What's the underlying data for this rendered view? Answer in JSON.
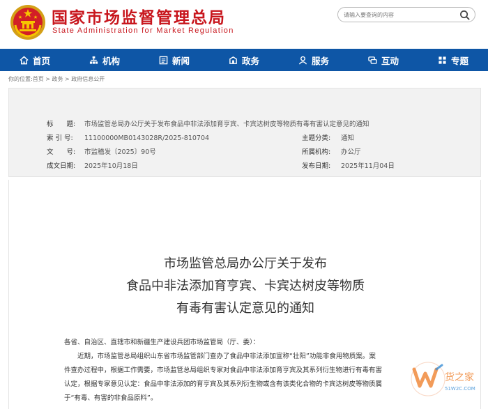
{
  "header": {
    "title": "国家市场监督管理总局",
    "subtitle": "State Administration for Market Regulation",
    "search_placeholder": "请输入要查询的内容"
  },
  "nav": [
    {
      "label": "首页",
      "icon": "home-icon"
    },
    {
      "label": "机构",
      "icon": "org-icon"
    },
    {
      "label": "新闻",
      "icon": "news-icon"
    },
    {
      "label": "政务",
      "icon": "affairs-icon"
    },
    {
      "label": "服务",
      "icon": "service-icon"
    },
    {
      "label": "互动",
      "icon": "chat-icon"
    },
    {
      "label": "专题",
      "icon": "topic-icon"
    }
  ],
  "breadcrumb": {
    "prefix": "你的位置:",
    "items": [
      "首页",
      "政务",
      "政府信息公开"
    ],
    "sep": " > "
  },
  "info": {
    "title_label": "标　　题:",
    "title_value": "市场监管总局办公厅关于发布食品中非法添加育亨宾、卡宾达树皮等物质有毒有害认定意见的通知",
    "index_label": "索 引 号:",
    "index_value": "11100000MB0143028R/2025-810704",
    "category_label": "主题分类:",
    "category_value": "通知",
    "docno_label": "文　　号:",
    "docno_value": "市监稽发〔2025〕90号",
    "org_label": "所属机构:",
    "org_value": "办公厅",
    "date_label": "成文日期:",
    "date_value": "2025年10月18日",
    "pub_label": "发布日期:",
    "pub_value": "2025年11月04日"
  },
  "article": {
    "title_lines": [
      "市场监管总局办公厅关于发布",
      "食品中非法添加育亨宾、卡宾达树皮等物质",
      "有毒有害认定意见的通知"
    ],
    "paragraphs": [
      "各省、自治区、直辖市和新疆生产建设兵团市场监管局（厅、委）：",
      "　　近期，市场监管总局组织山东省市场监管部门查办了食品中非法添加宣称“壮阳”功能非食用物质案。案",
      "件查办过程中，根据工作需要，市场监管总局组织专家对食品中非法添加育亨宾及其系列衍生物进行有毒有害",
      "认定，根据专家意见认定：食品中非法添加的育亨宾及其系列衍生物或含有该类化合物的卡宾达树皮等物质属",
      "于“有毒、有害的非食品原料”。"
    ]
  },
  "watermark": {
    "brand": "货之家",
    "url": "51W2C.COM"
  },
  "colors": {
    "brand_red": "#c8161d",
    "nav_blue": "#0e56a6",
    "panel_bg": "#f2f2f2"
  }
}
